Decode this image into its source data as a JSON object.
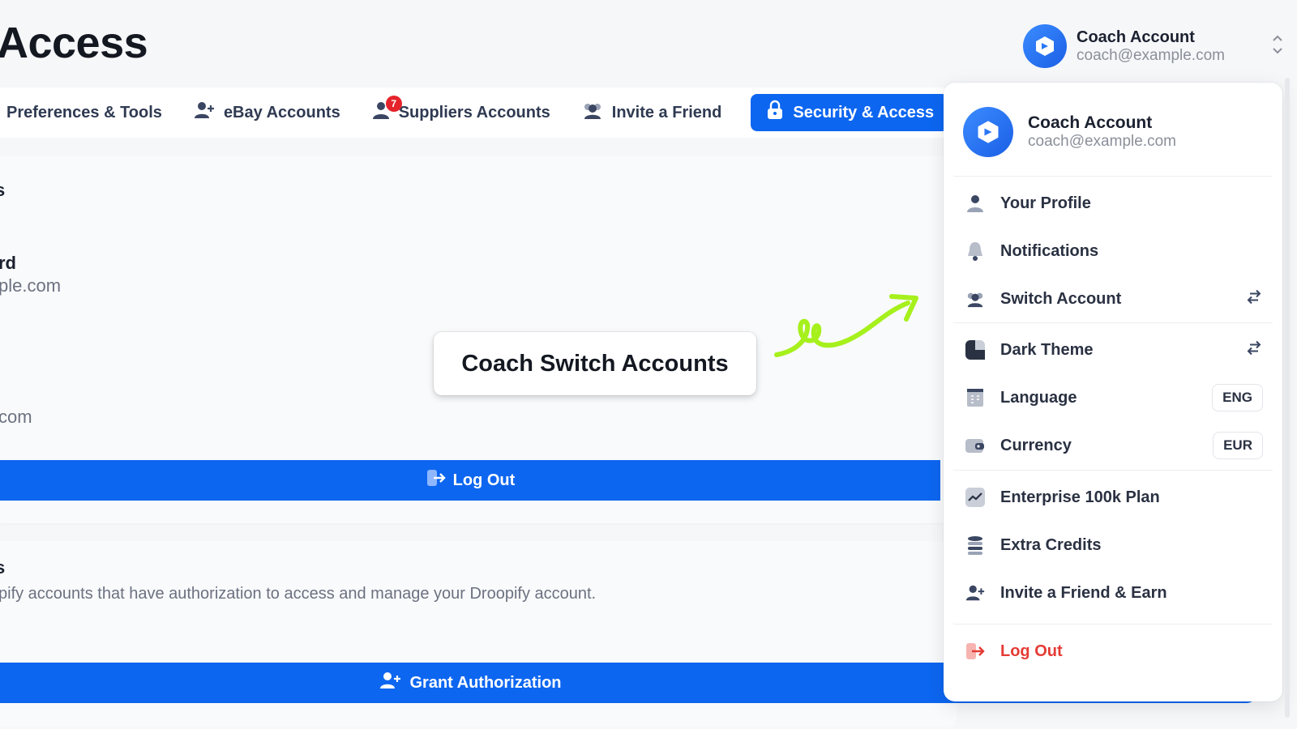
{
  "page": {
    "title": "Access"
  },
  "account": {
    "name": "Coach Account",
    "email": "coach@example.com"
  },
  "tabs": [
    {
      "label": "Preferences & Tools",
      "icon": "sliders-icon"
    },
    {
      "label": "eBay Accounts",
      "icon": "user-plus-icon"
    },
    {
      "label": "Suppliers Accounts",
      "icon": "user-icon",
      "badge": "7"
    },
    {
      "label": "Invite a Friend",
      "icon": "users-icon"
    },
    {
      "label": "Security & Access",
      "icon": "lock-icon",
      "active": true
    }
  ],
  "card1": {
    "frag_s": "s",
    "frag_rd": "rd",
    "frag_email": "ple.com",
    "frag_com": "com",
    "logout_label": "Log Out"
  },
  "card2": {
    "frag_s": "s",
    "description": "pify accounts that have authorization to access and manage your Droopify account.",
    "grant_label": "Grant Authorization"
  },
  "callout": {
    "text": "Coach Switch Accounts"
  },
  "dropdown": {
    "items": [
      {
        "label": "Your Profile",
        "icon": "user-icon"
      },
      {
        "label": "Notifications",
        "icon": "bell-icon"
      },
      {
        "label": "Switch Account",
        "icon": "users-icon",
        "right_icon": "swap-icon"
      },
      {
        "label": "Dark Theme",
        "icon": "theme-icon",
        "right_icon": "swap-icon"
      },
      {
        "label": "Language",
        "icon": "book-icon",
        "value": "ENG"
      },
      {
        "label": "Currency",
        "icon": "wallet-icon",
        "value": "EUR"
      },
      {
        "label": "Enterprise 100k Plan",
        "icon": "chart-icon"
      },
      {
        "label": "Extra Credits",
        "icon": "coins-icon"
      },
      {
        "label": "Invite a Friend & Earn",
        "icon": "user-plus-icon"
      },
      {
        "label": "Log Out",
        "icon": "logout-icon",
        "danger": true
      }
    ]
  },
  "colors": {
    "primary": "#0d66f0",
    "danger": "#e53b35",
    "arrow": "#a6f01c"
  }
}
